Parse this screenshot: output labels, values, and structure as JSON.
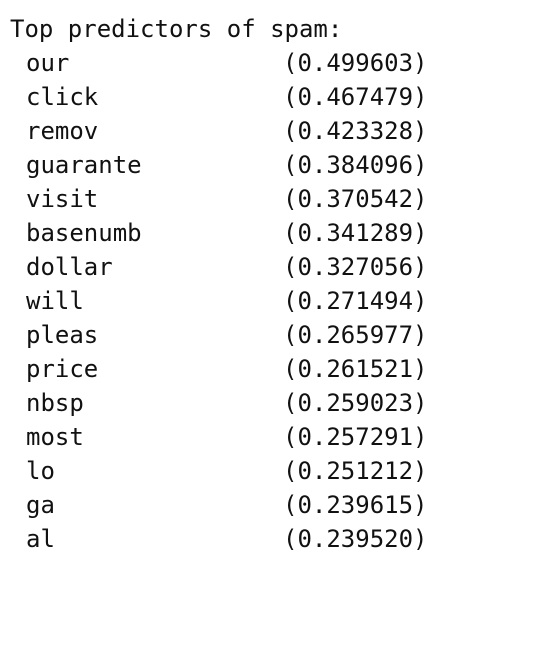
{
  "output": {
    "heading": "Top predictors of spam:",
    "predictors": [
      {
        "term": "our",
        "score": "(0.499603)"
      },
      {
        "term": "click",
        "score": "(0.467479)"
      },
      {
        "term": "remov",
        "score": "(0.423328)"
      },
      {
        "term": "guarante",
        "score": "(0.384096)"
      },
      {
        "term": "visit",
        "score": "(0.370542)"
      },
      {
        "term": "basenumb",
        "score": "(0.341289)"
      },
      {
        "term": "dollar",
        "score": "(0.327056)"
      },
      {
        "term": "will",
        "score": "(0.271494)"
      },
      {
        "term": "pleas",
        "score": "(0.265977)"
      },
      {
        "term": "price",
        "score": "(0.261521)"
      },
      {
        "term": "nbsp",
        "score": "(0.259023)"
      },
      {
        "term": "most",
        "score": "(0.257291)"
      },
      {
        "term": "lo",
        "score": "(0.251212)"
      },
      {
        "term": "ga",
        "score": "(0.239615)"
      },
      {
        "term": "al",
        "score": "(0.239520)"
      }
    ]
  }
}
